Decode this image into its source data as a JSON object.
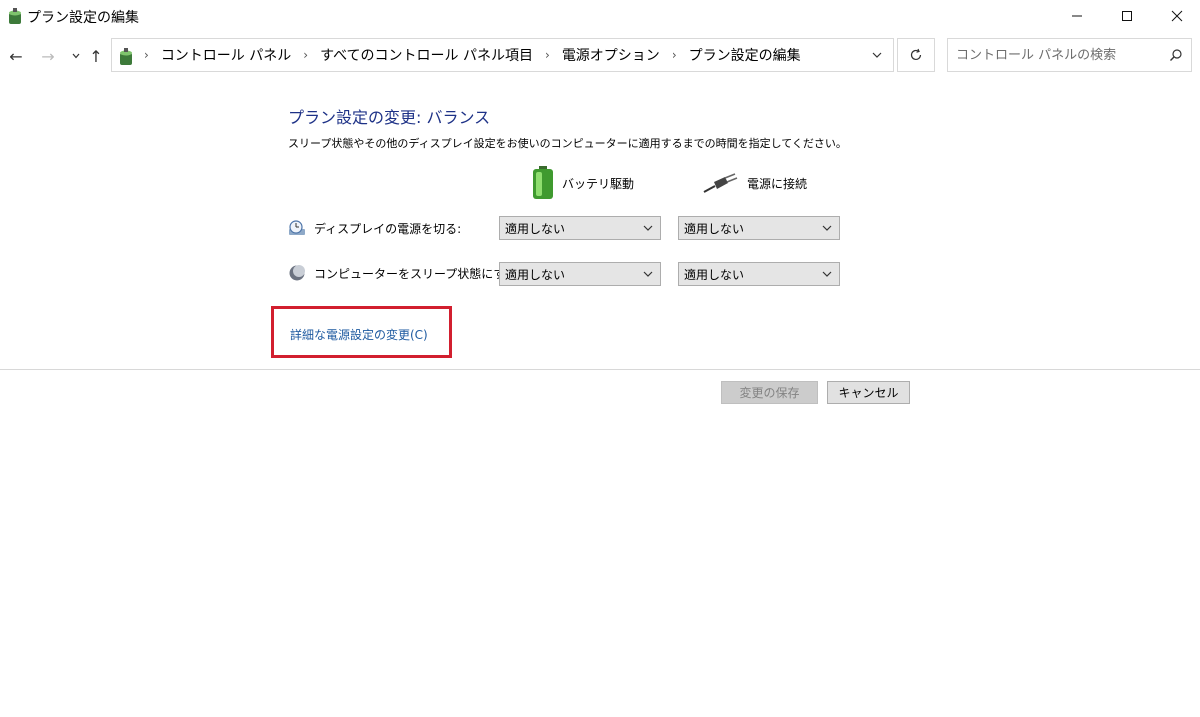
{
  "window": {
    "title": "プラン設定の編集"
  },
  "address_bar": {
    "breadcrumbs": [
      "コントロール パネル",
      "すべてのコントロール パネル項目",
      "電源オプション",
      "プラン設定の編集"
    ]
  },
  "search": {
    "placeholder": "コントロール パネルの検索"
  },
  "main": {
    "heading": "プラン設定の変更: バランス",
    "description": "スリープ状態やその他のディスプレイ設定をお使いのコンピューターに適用するまでの時間を指定してください。",
    "columns": {
      "battery": "バッテリ駆動",
      "plugged_in": "電源に接続"
    },
    "rows": [
      {
        "label": "ディスプレイの電源を切る:",
        "battery_value": "適用しない",
        "plugged_value": "適用しない"
      },
      {
        "label": "コンピューターをスリープ状態にする:",
        "battery_value": "適用しない",
        "plugged_value": "適用しない"
      }
    ],
    "advanced_link": "詳細な電源設定の変更(C)",
    "highlight_color": "#d21f2f"
  },
  "footer": {
    "save_label": "変更の保存",
    "cancel_label": "キャンセル"
  }
}
